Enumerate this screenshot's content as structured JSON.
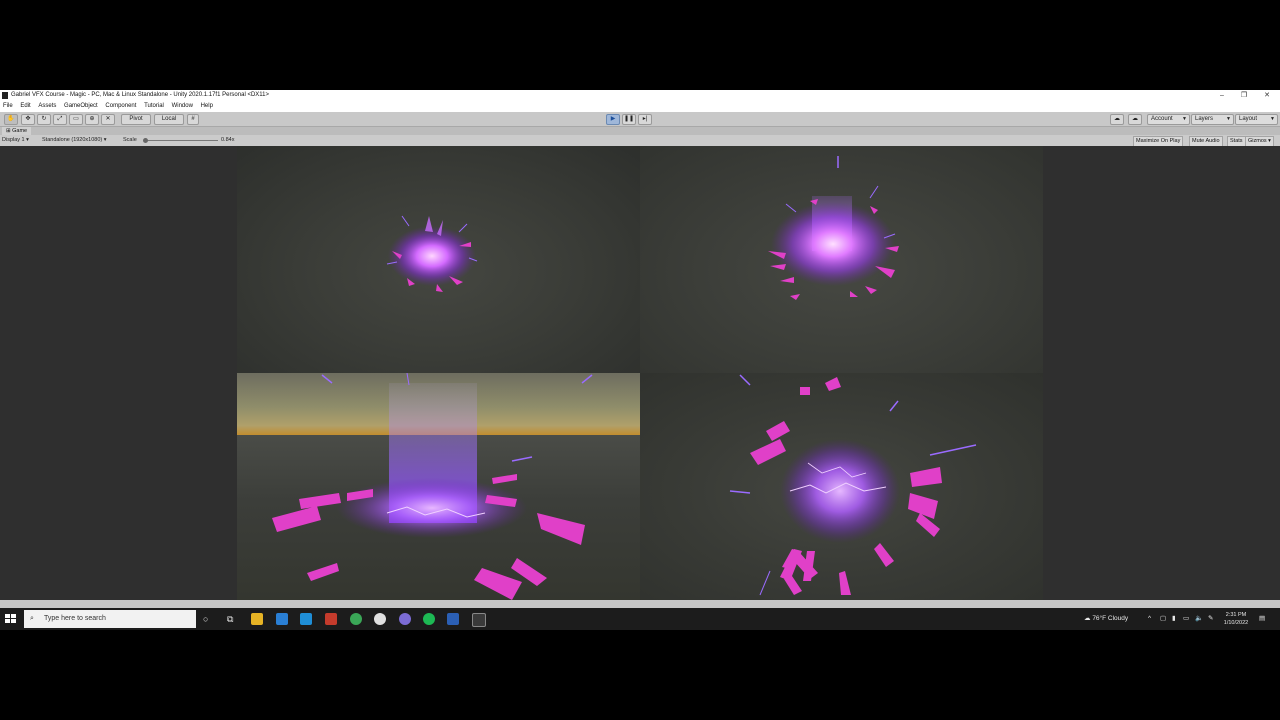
{
  "window": {
    "title": "Gabriel VFX Course - Magic - PC, Mac & Linux Standalone - Unity 2020.1.17f1 Personal <DX11>"
  },
  "menu": {
    "items": [
      "File",
      "Edit",
      "Assets",
      "GameObject",
      "Component",
      "Tutorial",
      "Window",
      "Help"
    ]
  },
  "toolbar": {
    "pivot_label": "Pivot",
    "local_label": "Local",
    "account_label": "Account",
    "layers_label": "Layers",
    "layout_label": "Layout",
    "play_state": "playing"
  },
  "game_tab": {
    "label": "Game"
  },
  "game_controls": {
    "display": "Display 1",
    "resolution": "Standalone (1920x1080)",
    "scale_label": "Scale",
    "scale_value": "0.84x",
    "maximize_on_play": "Maximize On Play",
    "mute_audio": "Mute Audio",
    "stats": "Stats",
    "gizmos": "Gizmos"
  },
  "taskbar": {
    "search_placeholder": "Type here to search",
    "weather": "76°F  Cloudy",
    "time": "2:31 PM",
    "date": "1/10/2022"
  },
  "colors": {
    "magic_purple": "#a64dff",
    "magic_pink": "#e040c8",
    "play_blue": "#1d4f9a"
  }
}
